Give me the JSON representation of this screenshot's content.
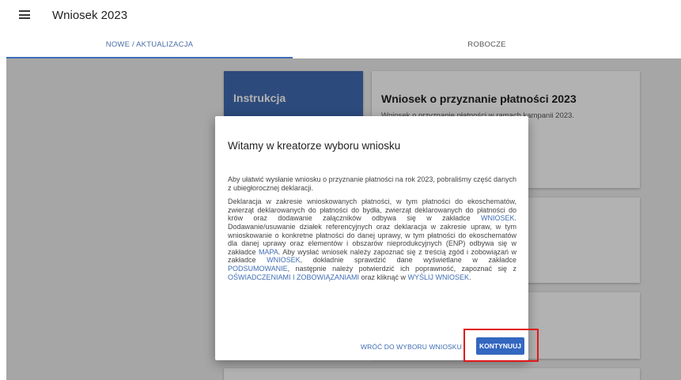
{
  "header": {
    "title": "Wniosek 2023",
    "menu_icon": "hamburger-menu-icon"
  },
  "tabs": [
    {
      "label": "NOWE / AKTUALIZACJA"
    },
    {
      "label": "ROBOCZE"
    }
  ],
  "cards": {
    "instruction": {
      "title": "Instrukcja"
    },
    "main": {
      "title": "Wniosek o przyznanie płatności 2023",
      "subtitle": "Wniosek o przyznanie płatności w ramach kampanii 2023."
    }
  },
  "dialog": {
    "title": "Witamy w kreatorze wyboru wniosku",
    "para1": "Aby ułatwić wysłanie wniosku o przyznanie płatności na rok 2023, pobraliśmy część danych z ubiegłorocznej deklaracji.",
    "p2": [
      "Deklaracja w zakresie wnioskowanych płatności, w tym płatności do ekoschematów, zwierząt deklarowanych do płatności do bydła, zwierząt deklarowanych do płatności do krów oraz dodawanie załączników odbywa się w zakładce ",
      "WNIOSEK",
      ". Dodawanie/usuwanie działek referencyjnych oraz deklaracja w zakresie upraw, w tym wnioskowanie o konkretne płatności do danej uprawy, w tym płatności do ekoschematów dla danej uprawy oraz elementów i obszarów nieprodukcyjnych (ENP) odbywa się w zakładce ",
      "MAPA",
      ". Aby wysłać wniosek należy zapoznać się z treścią zgód i zobowiązań w zakładce ",
      "WNIOSEK",
      ", dokładnie sprawdzić dane wyświetlane w zakładce ",
      "PODSUMOWANIE",
      ", następnie należy potwierdzić ich poprawność, zapoznać się z ",
      "OŚWIADCZENIAMI I ZOBOWIĄZANIAMI",
      " oraz kliknąć w ",
      "WYŚLIJ WNIOSEK",
      "."
    ],
    "back_label": "WRÓĆ DO WYBORU WNIOSKU",
    "continue_label": "KONTYNUUJ"
  },
  "colors": {
    "accent": "#3f6db3",
    "instruction_card": "#3f6bb0",
    "highlight": "#e01818"
  }
}
